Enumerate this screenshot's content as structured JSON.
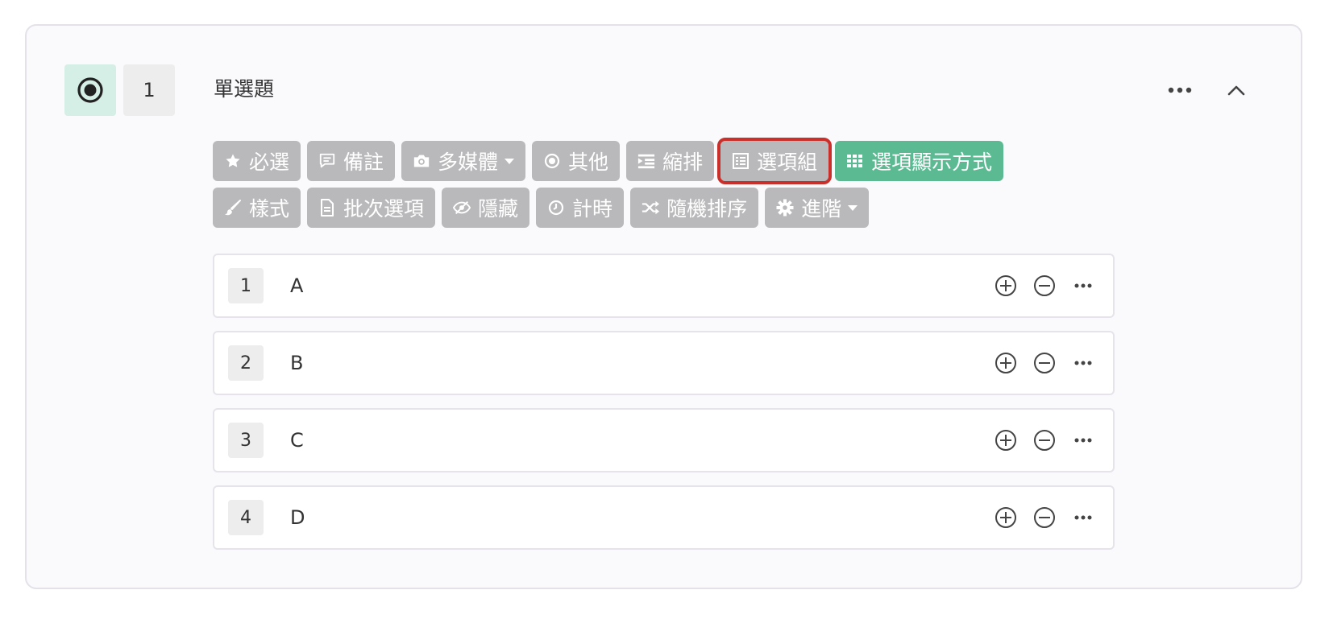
{
  "question": {
    "number": "1",
    "title": "單選題",
    "type_icon": "radio-dot-icon"
  },
  "header_actions": {
    "more_icon": "ellipsis-icon",
    "collapse_icon": "chevron-up-icon"
  },
  "toolbar": {
    "row1": [
      {
        "label": "必選",
        "icon": "star-icon"
      },
      {
        "label": "備註",
        "icon": "comment-icon"
      },
      {
        "label": "多媒體",
        "icon": "camera-icon",
        "dropdown": true
      },
      {
        "label": "其他",
        "icon": "radio-dot-icon"
      },
      {
        "label": "縮排",
        "icon": "indent-icon"
      },
      {
        "label": "選項組",
        "icon": "list-box-icon",
        "highlighted": true
      },
      {
        "label": "選項顯示方式",
        "icon": "grid-icon",
        "active": true
      }
    ],
    "row2": [
      {
        "label": "樣式",
        "icon": "brush-icon"
      },
      {
        "label": "批次選項",
        "icon": "file-icon"
      },
      {
        "label": "隱藏",
        "icon": "eye-slash-icon"
      },
      {
        "label": "計時",
        "icon": "clock-icon"
      },
      {
        "label": "隨機排序",
        "icon": "shuffle-icon"
      },
      {
        "label": "進階",
        "icon": "gear-icon",
        "dropdown": true
      }
    ]
  },
  "options": [
    {
      "number": "1",
      "text": "A"
    },
    {
      "number": "2",
      "text": "B"
    },
    {
      "number": "3",
      "text": "C"
    },
    {
      "number": "4",
      "text": "D"
    }
  ],
  "colors": {
    "button_gray": "#b9b9bb",
    "button_green": "#5cba93",
    "highlight_red": "#c9302c",
    "type_icon_bg": "#d6efe6"
  }
}
